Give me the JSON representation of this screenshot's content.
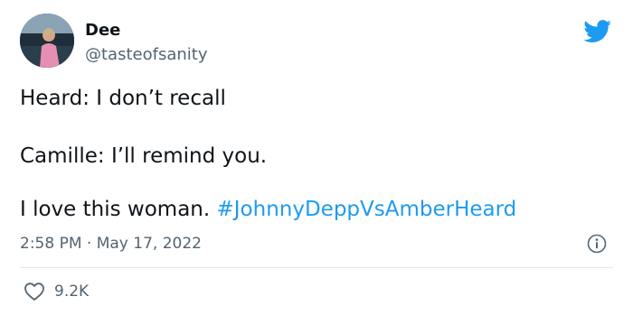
{
  "user": {
    "display_name": "Dee",
    "handle": "@tasteofsanity"
  },
  "tweet": {
    "line1": "Heard: I don’t recall",
    "line2": "Camille: I’ll remind you.",
    "line3_text": "I love this woman. ",
    "line3_hashtag": "#JohnnyDeppVsAmberHeard",
    "time": "2:58 PM",
    "separator": "·",
    "date": "May 17, 2022"
  },
  "stats": {
    "likes": "9.2K"
  },
  "icons": {
    "brand": "twitter-bird-icon",
    "info": "info-icon",
    "like": "heart-icon"
  },
  "colors": {
    "accent": "#1d9bf0",
    "text": "#0f1419",
    "secondary": "#536471",
    "divider": "#e1e8ed"
  }
}
